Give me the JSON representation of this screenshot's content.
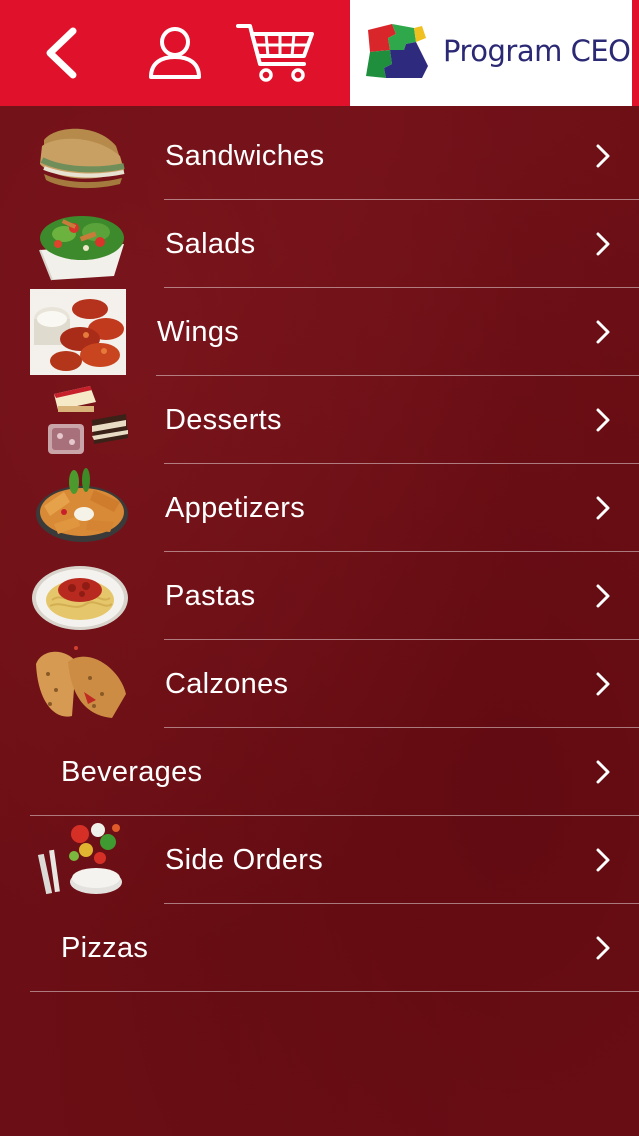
{
  "header": {
    "back_icon": "chevron-left-icon",
    "user_icon": "user-icon",
    "cart_icon": "shopping-cart-icon",
    "logo_text": "Program CEO",
    "colors": {
      "bar": "#e0112b",
      "logo_text": "#2b2874"
    }
  },
  "menu": {
    "items": [
      {
        "label": "Sandwiches",
        "icon": "sandwich-image"
      },
      {
        "label": "Salads",
        "icon": "salad-image"
      },
      {
        "label": "Wings",
        "icon": "wings-image"
      },
      {
        "label": "Desserts",
        "icon": "desserts-image"
      },
      {
        "label": "Appetizers",
        "icon": "appetizers-image"
      },
      {
        "label": "Pastas",
        "icon": "pasta-image"
      },
      {
        "label": "Calzones",
        "icon": "calzones-image"
      },
      {
        "label": "Beverages",
        "icon": ""
      },
      {
        "label": "Side Orders",
        "icon": "side-orders-image"
      },
      {
        "label": "Pizzas",
        "icon": ""
      }
    ],
    "chevron_icon": "chevron-right-icon"
  },
  "colors": {
    "background": "#6e0f16",
    "text": "#ffffff"
  }
}
